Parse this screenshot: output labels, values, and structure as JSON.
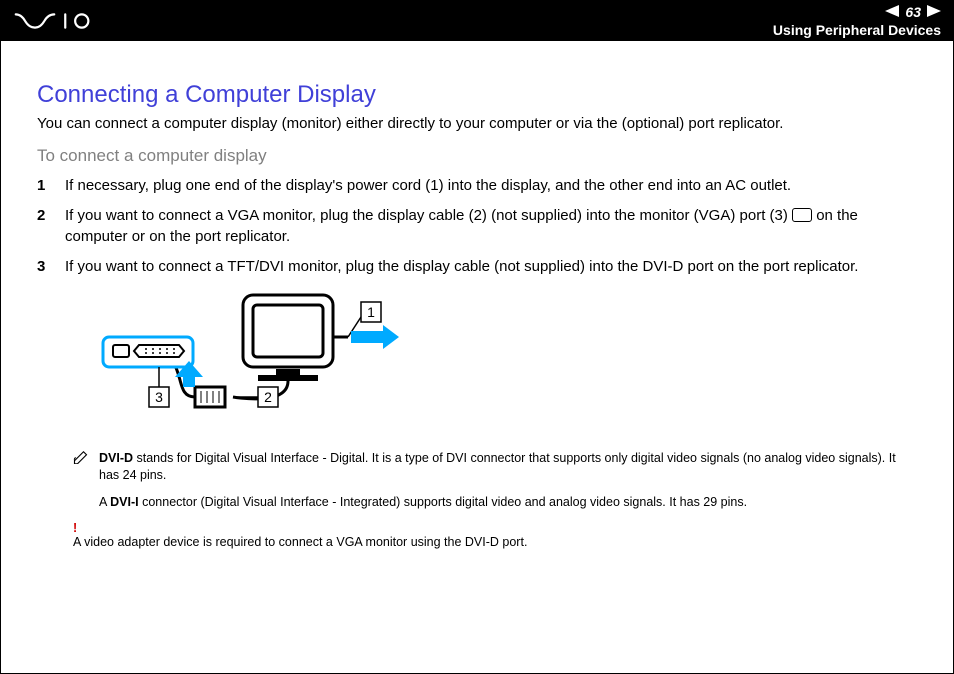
{
  "header": {
    "page_number": "63",
    "section": "Using Peripheral Devices"
  },
  "main": {
    "title": "Connecting a Computer Display",
    "intro": "You can connect a computer display (monitor) either directly to your computer or via the (optional) port replicator.",
    "subtitle": "To connect a computer display",
    "steps": [
      {
        "n": "1",
        "text": "If necessary, plug one end of the display's power cord (1) into the display, and the other end into an AC outlet."
      },
      {
        "n": "2",
        "text_a": "If you want to connect a VGA monitor, plug the display cable (2) (not supplied) into the monitor (VGA) port (3) ",
        "text_b": " on the computer or on the port replicator."
      },
      {
        "n": "3",
        "text": "If you want to connect a TFT/DVI monitor, plug the display cable (not supplied) into the DVI-D port on the port replicator."
      }
    ],
    "diagram_labels": {
      "l1": "1",
      "l2": "2",
      "l3": "3"
    },
    "note": {
      "bold1": "DVI-D",
      "rest1": " stands for Digital Visual Interface - Digital. It is a type of DVI connector that supports only digital video signals (no analog video signals). It has 24 pins.",
      "pre2": "A ",
      "bold2": "DVI-I",
      "rest2": " connector (Digital Visual Interface - Integrated) supports digital video and analog video signals. It has 29 pins."
    },
    "warn": {
      "mark": "!",
      "text": "A video adapter device is required to connect a VGA monitor using the DVI-D port."
    }
  }
}
